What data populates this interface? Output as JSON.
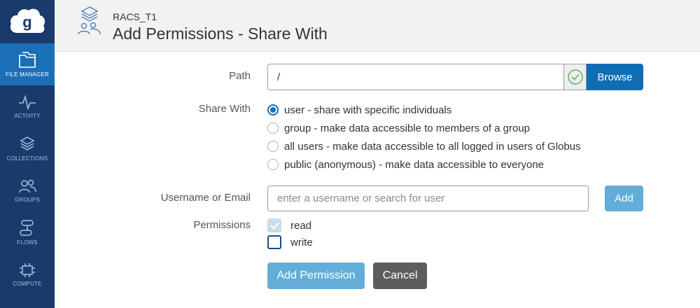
{
  "sidebar": {
    "logo_icon": "globus-cloud-logo",
    "items": [
      {
        "label": "FILE MANAGER",
        "icon": "folder-icon",
        "active": true
      },
      {
        "label": "ACTIVITY",
        "icon": "activity-pulse-icon",
        "active": false
      },
      {
        "label": "COLLECTIONS",
        "icon": "layers-icon",
        "active": false
      },
      {
        "label": "GROUPS",
        "icon": "users-icon",
        "active": false
      },
      {
        "label": "FLOWS",
        "icon": "flows-icon",
        "active": false
      },
      {
        "label": "COMPUTE",
        "icon": "compute-chip-icon",
        "active": false
      }
    ]
  },
  "header": {
    "icon": "shared-collection-icon",
    "collection_name": "RACS_T1",
    "title": "Add Permissions - Share With"
  },
  "form": {
    "path": {
      "label": "Path",
      "value": "/",
      "valid_icon": "check-circle-icon",
      "browse_label": "Browse"
    },
    "share_with": {
      "label": "Share With",
      "options": [
        {
          "label": "user - share with specific individuals",
          "checked": true
        },
        {
          "label": "group - make data accessible to members of a group",
          "checked": false
        },
        {
          "label": "all users - make data accessible to all logged in users of Globus",
          "checked": false
        },
        {
          "label": "public (anonymous) - make data accessible to everyone",
          "checked": false
        }
      ]
    },
    "username": {
      "label": "Username or Email",
      "placeholder": "enter a username or search for user",
      "value": "",
      "add_label": "Add"
    },
    "permissions": {
      "label": "Permissions",
      "read": {
        "label": "read",
        "checked": true,
        "disabled": true
      },
      "write": {
        "label": "write",
        "checked": false
      }
    },
    "actions": {
      "submit_label": "Add Permission",
      "cancel_label": "Cancel"
    }
  },
  "colors": {
    "sidebar_bg": "#1a3a6b",
    "sidebar_active": "#1b6fb7",
    "primary": "#0f6eb3",
    "primary_light": "#63aed8",
    "cancel": "#5d5d5d",
    "valid_green": "#5cb85c"
  }
}
